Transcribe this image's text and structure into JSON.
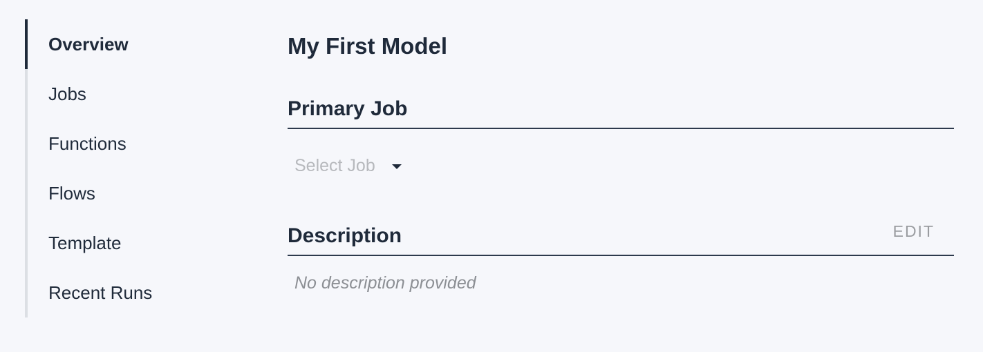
{
  "sidebar": {
    "items": [
      {
        "label": "Overview",
        "active": true
      },
      {
        "label": "Jobs",
        "active": false
      },
      {
        "label": "Functions",
        "active": false
      },
      {
        "label": "Flows",
        "active": false
      },
      {
        "label": "Template",
        "active": false
      },
      {
        "label": "Recent Runs",
        "active": false
      }
    ]
  },
  "main": {
    "title": "My First Model",
    "primary_job": {
      "heading": "Primary Job",
      "select": {
        "placeholder": "Select Job",
        "icon": "caret-down-icon"
      }
    },
    "description": {
      "heading": "Description",
      "edit_label": "EDIT",
      "text": "No description provided"
    }
  },
  "colors": {
    "background": "#f6f7fb",
    "text": "#1f2a3a",
    "muted": "#9a9ca0",
    "placeholder": "#b7b9bd",
    "rail": "#dcdfe4",
    "divider": "#2d3a4d"
  }
}
